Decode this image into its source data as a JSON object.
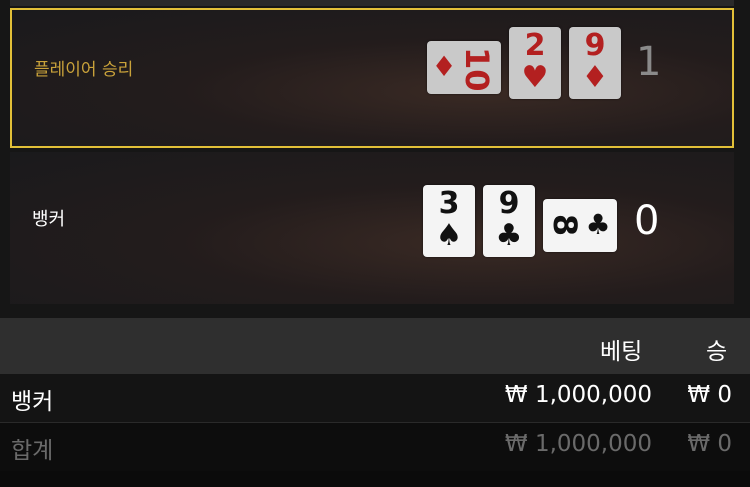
{
  "player": {
    "label": "플레이어 승리",
    "score": "1",
    "cards": [
      {
        "rank": "10",
        "suit": "♦"
      },
      {
        "rank": "2",
        "suit": "♥"
      },
      {
        "rank": "9",
        "suit": "♦"
      }
    ]
  },
  "banker": {
    "label": "뱅커",
    "score": "0",
    "cards": [
      {
        "rank": "3",
        "suit": "♠"
      },
      {
        "rank": "9",
        "suit": "♣"
      },
      {
        "rank": "8",
        "suit": "♣"
      }
    ]
  },
  "table": {
    "header_bet": "베팅",
    "header_win": "승",
    "rows": [
      {
        "name": "뱅커",
        "bet": "₩ 1,000,000",
        "win": "₩ 0"
      },
      {
        "name": "합계",
        "bet": "₩ 1,000,000",
        "win": "₩ 0"
      }
    ]
  },
  "colors": {
    "win_border": "#e2c038",
    "win_label": "#c9a23a",
    "red_suit": "#d42626"
  }
}
